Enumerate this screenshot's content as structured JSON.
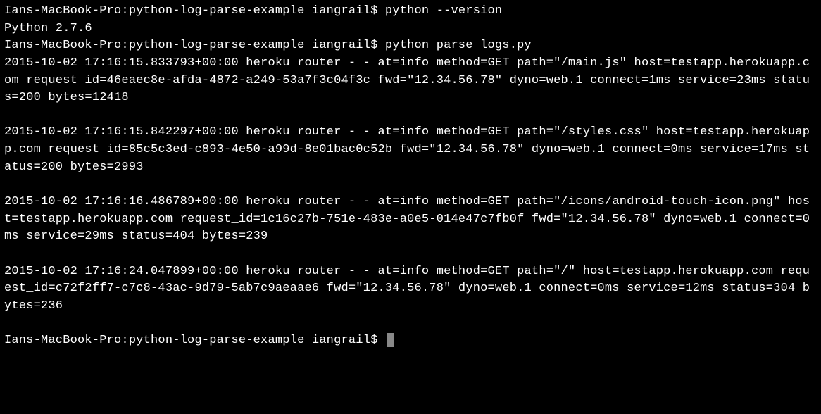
{
  "terminal": {
    "prompt1": "Ians-MacBook-Pro:python-log-parse-example iangrail$ ",
    "command1": "python --version",
    "output1": "Python 2.7.6",
    "prompt2": "Ians-MacBook-Pro:python-log-parse-example iangrail$ ",
    "command2": "python parse_logs.py",
    "log1": "2015-10-02 17:16:15.833793+00:00 heroku router - - at=info method=GET path=\"/main.js\" host=testapp.herokuapp.com request_id=46eaec8e-afda-4872-a249-53a7f3c04f3c fwd=\"12.34.56.78\" dyno=web.1 connect=1ms service=23ms status=200 bytes=12418",
    "log2": "2015-10-02 17:16:15.842297+00:00 heroku router - - at=info method=GET path=\"/styles.css\" host=testapp.herokuapp.com request_id=85c5c3ed-c893-4e50-a99d-8e01bac0c52b fwd=\"12.34.56.78\" dyno=web.1 connect=0ms service=17ms status=200 bytes=2993",
    "log3": "2015-10-02 17:16:16.486789+00:00 heroku router - - at=info method=GET path=\"/icons/android-touch-icon.png\" host=testapp.herokuapp.com request_id=1c16c27b-751e-483e-a0e5-014e47c7fb0f fwd=\"12.34.56.78\" dyno=web.1 connect=0ms service=29ms status=404 bytes=239",
    "log4": "2015-10-02 17:16:24.047899+00:00 heroku router - - at=info method=GET path=\"/\" host=testapp.herokuapp.com request_id=c72f2ff7-c7c8-43ac-9d79-5ab7c9aeaae6 fwd=\"12.34.56.78\" dyno=web.1 connect=0ms service=12ms status=304 bytes=236",
    "prompt3": "Ians-MacBook-Pro:python-log-parse-example iangrail$ "
  }
}
